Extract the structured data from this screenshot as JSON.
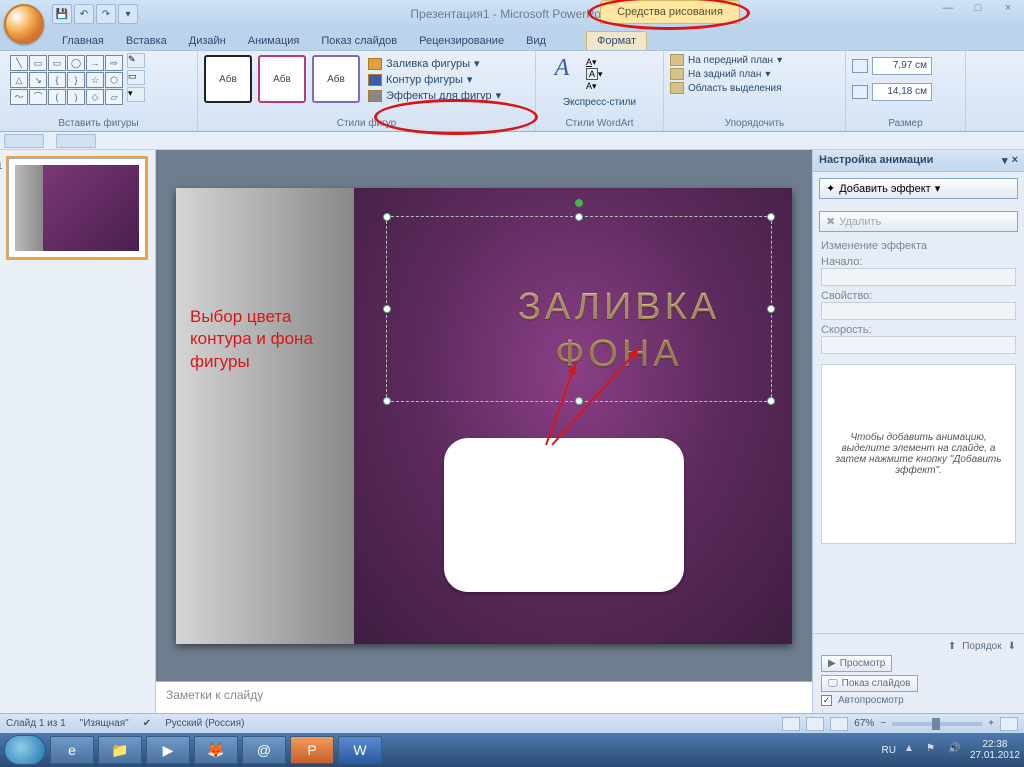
{
  "titlebar": {
    "title": "Презентация1 - Microsoft PowerPoint",
    "contextual": "Средства рисования",
    "win_min": "—",
    "win_max": "□",
    "win_close": "×"
  },
  "tabs": {
    "home": "Главная",
    "insert": "Вставка",
    "design": "Дизайн",
    "animation": "Анимация",
    "slideshow": "Показ слайдов",
    "review": "Рецензирование",
    "view": "Вид",
    "format": "Формат"
  },
  "ribbon": {
    "insert_shapes": "Вставить фигуры",
    "shape_styles": "Стили фигур",
    "style_label": "Абв",
    "fill": "Заливка фигуры",
    "outline": "Контур фигуры",
    "effects": "Эффекты для фигур",
    "wordart": "Стили WordArt",
    "express": "Экспресс-стили",
    "wa_letter": "A",
    "arrange": "Упорядочить",
    "bring_front": "На передний план",
    "send_back": "На задний план",
    "selection_pane": "Область выделения",
    "size": "Размер",
    "height": "7,97 см",
    "width": "14,18 см"
  },
  "slide": {
    "annotation": "Выбор цвета контура и фона фигуры",
    "wordart_line1": "ЗАЛИВКА",
    "wordart_line2": "ФОНА",
    "thumb_num": "1"
  },
  "notes": {
    "placeholder": "Заметки к слайду"
  },
  "taskpane": {
    "title": "Настройка анимации",
    "close": "×",
    "add_effect": "Добавить эффект",
    "remove": "Удалить",
    "change_effect": "Изменение эффекта",
    "start": "Начало:",
    "property": "Свойство:",
    "speed": "Скорость:",
    "help_text": "Чтобы добавить анимацию, выделите элемент на слайде, а затем нажмите кнопку \"Добавить эффект\".",
    "order": "Порядок",
    "preview": "Просмотр",
    "slideshow": "Показ слайдов",
    "autopreview": "Автопросмотр"
  },
  "status": {
    "slide_info": "Слайд 1 из 1",
    "theme": "\"Изящная\"",
    "lang": "Русский (Россия)",
    "zoom": "67%"
  },
  "tray": {
    "lang": "RU",
    "time": "22:38",
    "date": "27.01.2012"
  }
}
